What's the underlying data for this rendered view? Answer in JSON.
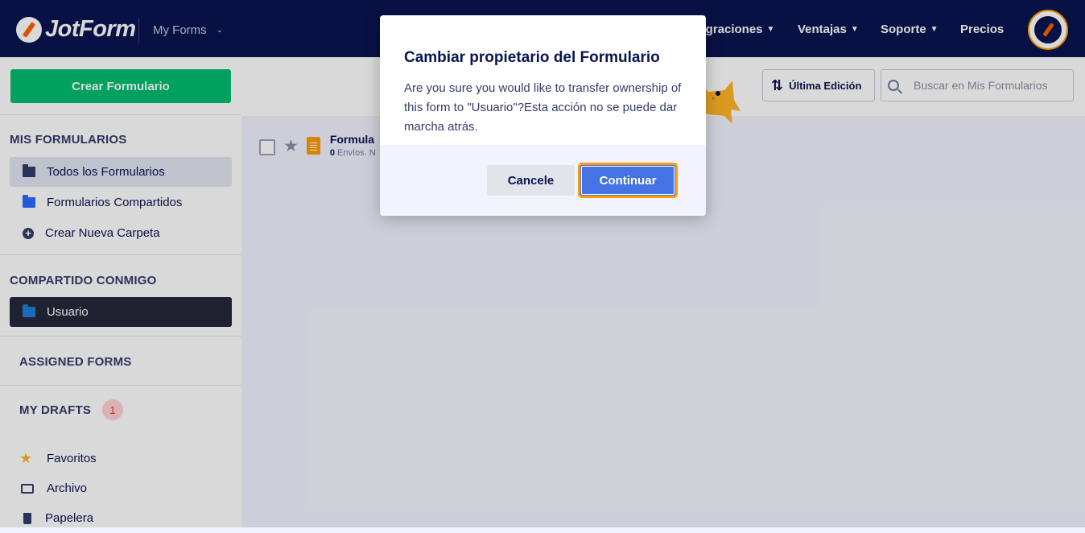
{
  "topbar": {
    "logo_text": "JotForm",
    "my_forms": "My Forms",
    "nav": [
      {
        "label": "Integraciones"
      },
      {
        "label": "Ventajas"
      },
      {
        "label": "Soporte"
      },
      {
        "label": "Precios"
      }
    ]
  },
  "sidebar": {
    "create_button": "Crear Formulario",
    "mis_formularios": {
      "title": "MIS FORMULARIOS",
      "items": [
        {
          "label": "Todos los Formularios",
          "icon": "folder-icon"
        },
        {
          "label": "Formularios Compartidos",
          "icon": "shared-folder-icon"
        },
        {
          "label": "Crear Nueva Carpeta",
          "icon": "add-circle-icon"
        }
      ]
    },
    "compartido": {
      "title": "COMPARTIDO CONMIGO",
      "items": [
        {
          "label": "Usuario",
          "icon": "folder-icon"
        }
      ]
    },
    "assigned_title": "ASSIGNED FORMS",
    "drafts": {
      "title": "MY DRAFTS",
      "count": "1"
    },
    "bottom_items": [
      {
        "label": "Favoritos",
        "icon": "star-icon"
      },
      {
        "label": "Archivo",
        "icon": "inbox-icon"
      },
      {
        "label": "Papelera",
        "icon": "trash-icon"
      }
    ]
  },
  "toolbar": {
    "sort_label": "Última Edición",
    "search_placeholder": "Buscar en Mis Formularios"
  },
  "form_list": [
    {
      "title": "Formula",
      "count": "0",
      "meta": "Envíos. N"
    }
  ],
  "modal": {
    "title": "Cambiar propietario del Formulario",
    "body": "Are you sure you would like to transfer ownership of this form to \"Usuario\"?Esta acción no se puede dar marcha atrás.",
    "cancel_label": "Cancele",
    "continue_label": "Continuar"
  },
  "colors": {
    "topbar": "#0a1551",
    "create_button": "#01bd6f",
    "continue_button": "#4573e3",
    "focus_ring": "#ff9d00",
    "badge_text": "#e53636"
  }
}
